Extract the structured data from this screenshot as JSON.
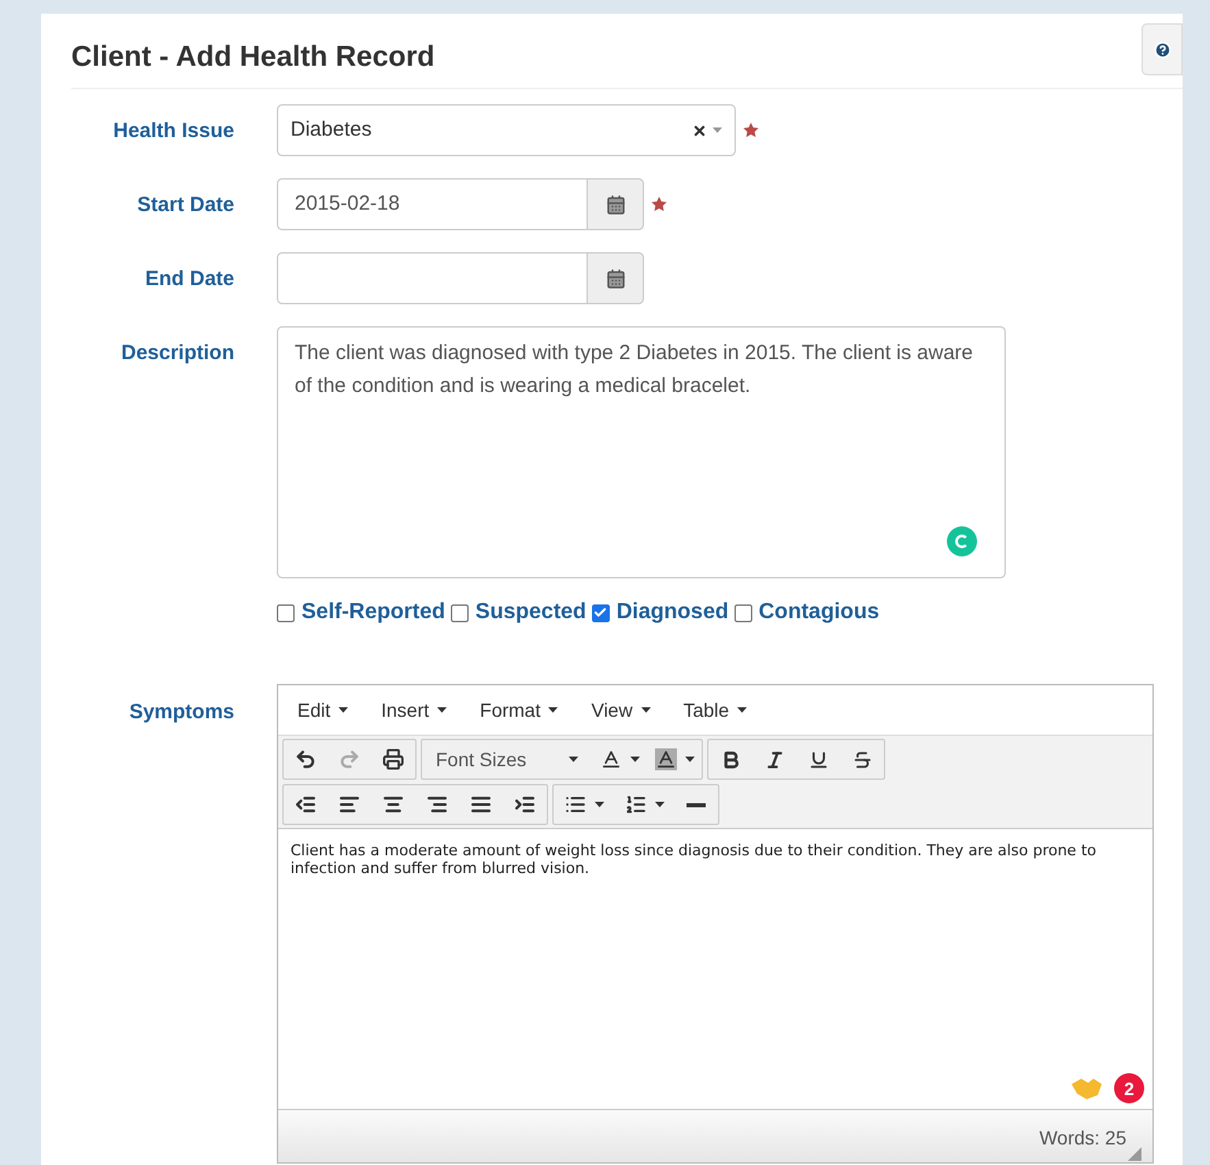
{
  "title": "Client - Add Health Record",
  "fields": [
    {
      "kind": "select",
      "label": "Health Issue",
      "value": "Diabetes",
      "required": true
    },
    {
      "kind": "date",
      "label": "Start Date",
      "value": "2015-02-18",
      "required": true
    },
    {
      "kind": "date",
      "label": "End Date",
      "required": false
    },
    {
      "kind": "textarea",
      "label": "Description",
      "value": "The client was diagnosed with type 2 Diabetes in 2015. The client is aware of the condition and is wearing a medical bracelet."
    }
  ],
  "flags": [
    {
      "label": "Self-Reported",
      "checked": false
    },
    {
      "label": "Suspected",
      "checked": false
    },
    {
      "label": "Diagnosed",
      "checked": true
    },
    {
      "label": "Contagious",
      "checked": false
    }
  ],
  "symptoms": {
    "label": "Symptoms",
    "menus": [
      "Edit",
      "Insert",
      "Format",
      "View",
      "Table"
    ],
    "font_sizes": "Font Sizes",
    "content": "Client has a moderate amount of weight loss since diagnosis due to their condition. They are also prone to infection and suffer from blurred vision.",
    "alerts": "2",
    "word_count": "Words: 25"
  }
}
